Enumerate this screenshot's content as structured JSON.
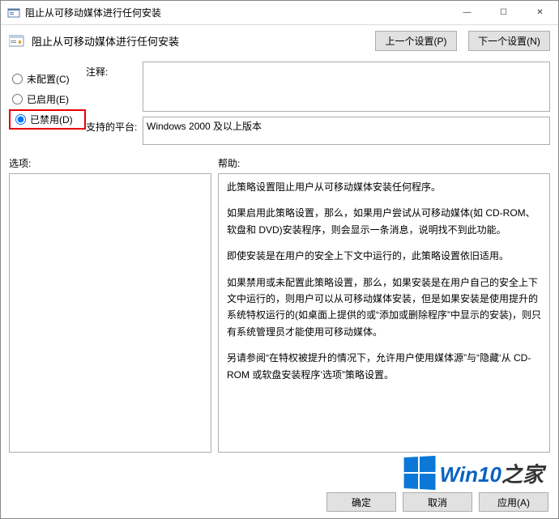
{
  "window": {
    "title": "阻止从可移动媒体进行任何安装",
    "minimize": "—",
    "maximize": "☐",
    "close": "✕"
  },
  "header": {
    "title": "阻止从可移动媒体进行任何安装",
    "prev_btn": "上一个设置(P)",
    "next_btn": "下一个设置(N)"
  },
  "radios": {
    "not_configured": "未配置(C)",
    "enabled": "已启用(E)",
    "disabled": "已禁用(D)",
    "selected": "disabled"
  },
  "fields": {
    "comment_label": "注释:",
    "comment_value": "",
    "platform_label": "支持的平台:",
    "platform_value": "Windows 2000 及以上版本"
  },
  "sections": {
    "options_label": "选项:",
    "help_label": "帮助:"
  },
  "help": {
    "p1": "此策略设置阻止用户从可移动媒体安装任何程序。",
    "p2": "如果启用此策略设置，那么，如果用户尝试从可移动媒体(如 CD-ROM、软盘和 DVD)安装程序，则会显示一条消息，说明找不到此功能。",
    "p3": "即使安装是在用户的安全上下文中运行的，此策略设置依旧适用。",
    "p4": "如果禁用或未配置此策略设置，那么，如果安装是在用户自己的安全上下文中运行的，则用户可以从可移动媒体安装，但是如果安装是使用提升的系统特权运行的(如桌面上提供的或“添加或删除程序”中显示的安装)，则只有系统管理员才能使用可移动媒体。",
    "p5": "另请参阅“在特权被提升的情况下，允许用户使用媒体源”与“隐藏‘从 CD-ROM 或软盘安装程序’选项”策略设置。"
  },
  "footer": {
    "ok": "确定",
    "cancel": "取消",
    "apply": "应用(A)"
  },
  "watermark": {
    "text_a": "Win10",
    "text_b": "之家"
  }
}
